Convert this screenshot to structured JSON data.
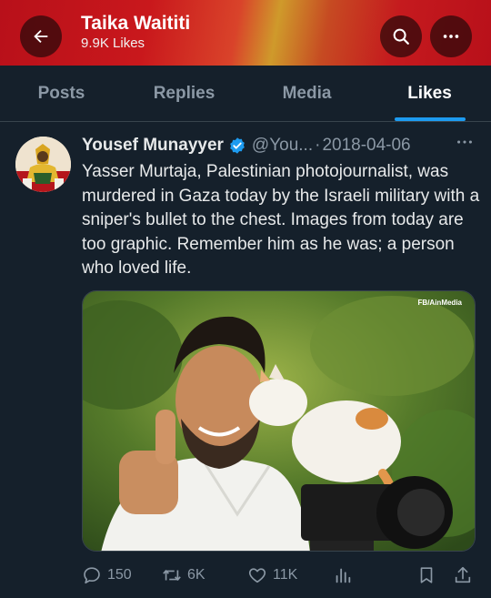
{
  "header": {
    "title": "Taika Waititi",
    "subtitle": "9.9K Likes",
    "back_icon": "arrow-left-icon",
    "search_icon": "search-icon",
    "more_icon": "more-horizontal-icon",
    "gradient_colors": [
      "#c51a1e",
      "#cf9a2b"
    ]
  },
  "tabs": [
    {
      "label": "Posts",
      "active": false
    },
    {
      "label": "Replies",
      "active": false
    },
    {
      "label": "Media",
      "active": false
    },
    {
      "label": "Likes",
      "active": true
    }
  ],
  "tweet": {
    "author": "Yousef Munayyer",
    "handle": "@You...",
    "separator": "·",
    "date": "2018-04-06",
    "text": "Yasser Murtaja, Palestinian photojournalist, was murdered in Gaza today by the Israeli military with a sniper's bullet to the chest. Images from today are too graphic. Remember him as he was; a person who loved life.",
    "media_credit": "FB/AinMedia",
    "actions": {
      "replies": "150",
      "reposts": "6K",
      "likes": "11K"
    }
  },
  "colors": {
    "background": "#15202b",
    "accent": "#1d9bf0",
    "muted": "#8b98a5",
    "text": "#e7e9ea"
  }
}
